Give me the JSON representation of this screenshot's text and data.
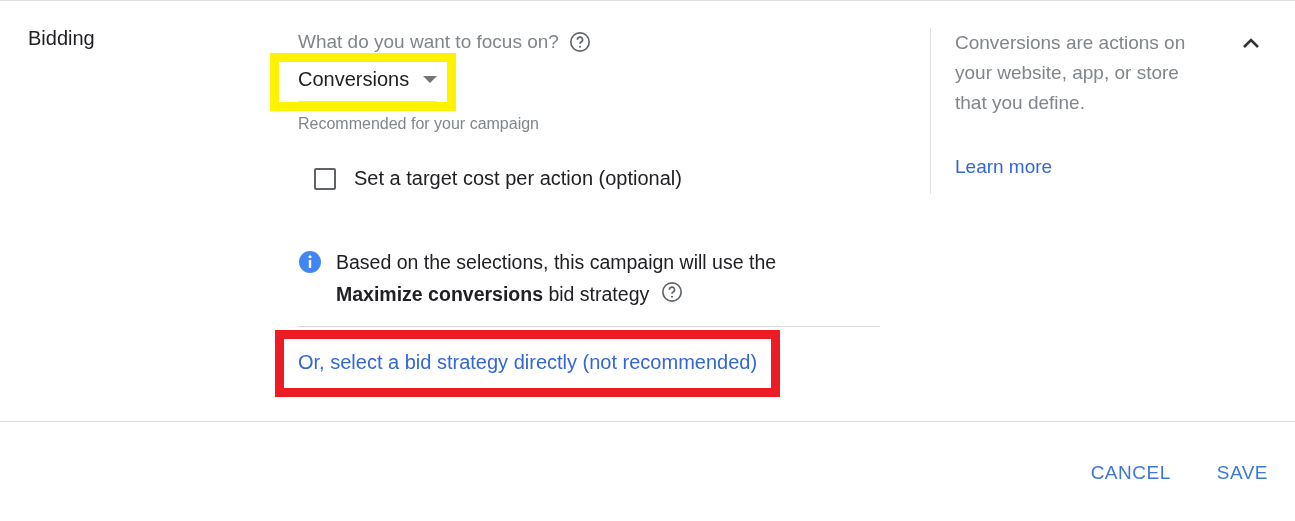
{
  "section": {
    "title": "Bidding",
    "expanded": true
  },
  "focus": {
    "question": "What do you want to focus on?",
    "dropdown": {
      "value": "Conversions",
      "highlight": {
        "color": "#fff200"
      }
    },
    "hint": "Recommended for your campaign"
  },
  "target_cpa": {
    "label": "Set a target cost per action (optional)",
    "checked": false
  },
  "info": {
    "text": "Based on the selections, this campaign will use the **Maximize conversions** bid strategy"
  },
  "direct_link": {
    "label": "Or, select a bid strategy directly (not recommended)",
    "highlight": {
      "color": "#ed1c24"
    }
  },
  "help_panel": {
    "text": "Conversions are actions on your website, app, or store that you define.",
    "link": "Learn more"
  },
  "buttons": [
    {
      "label": "CANCEL"
    },
    {
      "label": "SAVE"
    }
  ]
}
